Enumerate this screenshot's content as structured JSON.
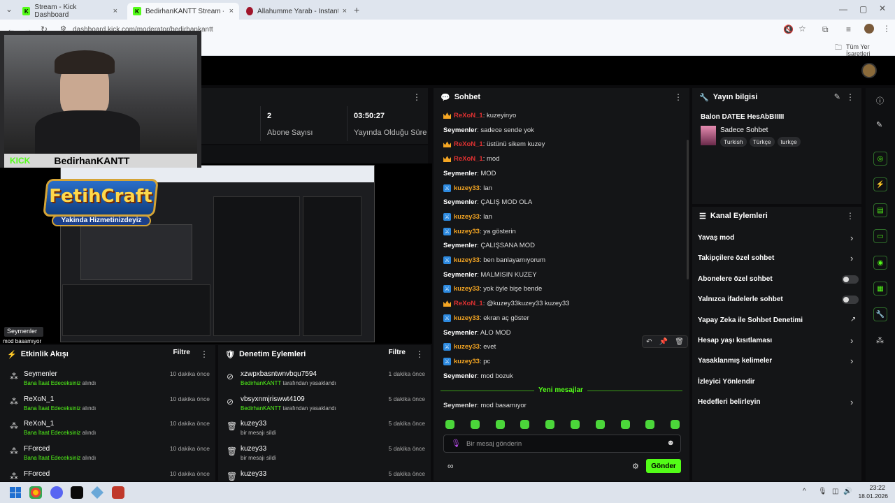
{
  "browser": {
    "tabs": [
      {
        "title": "Stream - Kick Dashboard"
      },
      {
        "title": "BedirhanKANTT Stream - Ki"
      },
      {
        "title": "Allahumme Yarab - Instant Sou"
      }
    ],
    "url": "dashboard.kick.com/moderator/bedirhankantt",
    "bookmarks_label": "Tüm Yer İşaretleri"
  },
  "webcam": {
    "brand": "KICK",
    "streamer": "BedirhanKANTT"
  },
  "overlay": {
    "title": "FetihCraft",
    "subtitle": "Yakinda Hizmetinizdeyiz",
    "chat_user": "Seymenler",
    "chat_text": "mod basamıyor"
  },
  "stats": {
    "subs_value": "2",
    "subs_label": "Abone Sayısı",
    "time_value": "03:50:27",
    "time_label": "Yayında Olduğu Süre"
  },
  "chat": {
    "title": "Sohbet",
    "messages": [
      {
        "user": "ReXoN_1",
        "text": ": kuzeyinyo",
        "badge": "crown",
        "color": "#e03131"
      },
      {
        "user": "Seymenler",
        "text": ": sadece sende yok",
        "badge": "",
        "color": "#ffffff"
      },
      {
        "user": "ReXoN_1",
        "text": ": üstünü sikem kuzey",
        "badge": "crown",
        "color": "#e03131"
      },
      {
        "user": "ReXoN_1",
        "text": ": mod",
        "badge": "crown",
        "color": "#e03131"
      },
      {
        "user": "Seymenler",
        "text": ": MOD",
        "badge": "",
        "color": "#ffffff"
      },
      {
        "user": "kuzey33",
        "text": ": lan",
        "badge": "mod",
        "color": "#f5a623"
      },
      {
        "user": "Seymenler",
        "text": ": ÇALIŞ MOD OLA",
        "badge": "",
        "color": "#ffffff"
      },
      {
        "user": "kuzey33",
        "text": ": lan",
        "badge": "mod",
        "color": "#f5a623"
      },
      {
        "user": "kuzey33",
        "text": ": ya gösterin",
        "badge": "mod",
        "color": "#f5a623"
      },
      {
        "user": "Seymenler",
        "text": ": ÇALIŞSANA MOD",
        "badge": "",
        "color": "#ffffff"
      },
      {
        "user": "kuzey33",
        "text": ": ben banlayamıyorum",
        "badge": "mod",
        "color": "#f5a623"
      },
      {
        "user": "Seymenler",
        "text": ": MALMISIN KUZEY",
        "badge": "",
        "color": "#ffffff"
      },
      {
        "user": "kuzey33",
        "text": ": yok öyle bişe bende",
        "badge": "mod",
        "color": "#f5a623"
      },
      {
        "user": "ReXoN_1",
        "text": ": @kuzey33kuzey33 kuzey33",
        "badge": "crown",
        "color": "#e03131"
      },
      {
        "user": "kuzey33",
        "text": ": ekran aç göster",
        "badge": "mod",
        "color": "#f5a623"
      },
      {
        "user": "Seymenler",
        "text": ": ALO MOD",
        "badge": "",
        "color": "#ffffff"
      },
      {
        "user": "kuzey33",
        "text": ": evet",
        "badge": "mod",
        "color": "#f5a623"
      },
      {
        "user": "kuzey33",
        "text": ": pc",
        "badge": "mod",
        "color": "#f5a623"
      },
      {
        "user": "Seymenler",
        "text": ": mod bozuk",
        "badge": "",
        "color": "#ffffff"
      }
    ],
    "new_messages_label": "Yeni mesajlar",
    "last_message": {
      "user": "Seymenler",
      "text": ": mod basamıyor"
    },
    "input_placeholder": "Bir mesaj gönderin",
    "send_label": "Gönder"
  },
  "stream_info": {
    "title": "Yayın bilgisi",
    "stream_title": "Balon DATEE HesAbBIIIII",
    "category": "Sadece Sohbet",
    "tags": [
      "Turkish",
      "Türkçe",
      "turkçe"
    ]
  },
  "channel_actions": {
    "title": "Kanal Eylemleri",
    "items": [
      {
        "label": "Yavaş mod",
        "control": "chevron"
      },
      {
        "label": "Takipçilere özel sohbet",
        "control": "chevron"
      },
      {
        "label": "Abonelere özel sohbet",
        "control": "toggle"
      },
      {
        "label": "Yalnızca ifadelerle sohbet",
        "control": "toggle"
      },
      {
        "label": "Yapay Zeka ile Sohbet Denetimi",
        "control": "external"
      },
      {
        "label": "Hesap yaşı kısıtlaması",
        "control": "chevron"
      },
      {
        "label": "Yasaklanmış kelimeler",
        "control": "chevron"
      },
      {
        "label": "İzleyici Yönlendir",
        "control": "none"
      },
      {
        "label": "Hedefleri belirleyin",
        "control": "chevron"
      }
    ]
  },
  "activity": {
    "title": "Etkinlik Akışı",
    "filter_label": "Filtre",
    "items": [
      {
        "name": "Seymenler",
        "reward": "Bana İtaat Edeceksiniz",
        "suffix": "alındı",
        "time": "10 dakika önce"
      },
      {
        "name": "ReXoN_1",
        "reward": "Bana İtaat Edeceksiniz",
        "suffix": "alındı",
        "time": "10 dakika önce"
      },
      {
        "name": "ReXoN_1",
        "reward": "Bana İtaat Edeceksiniz",
        "suffix": "alındı",
        "time": "10 dakika önce"
      },
      {
        "name": "FForced",
        "reward": "Bana İtaat Edeceksiniz",
        "suffix": "alındı",
        "time": "10 dakika önce"
      },
      {
        "name": "FForced",
        "reward": "",
        "suffix": "",
        "time": "10 dakika önce"
      }
    ]
  },
  "moderation": {
    "title": "Denetim Eylemleri",
    "filter_label": "Filtre",
    "items": [
      {
        "name": "xzwpxbasntwnvbqu7594",
        "actor": "BedirhanKANTT",
        "suffix": "tarafından yasaklandı",
        "time": "1 dakika önce",
        "icon": "ban"
      },
      {
        "name": "vbsyxnmjriswwt4109",
        "actor": "BedirhanKANTT",
        "suffix": "tarafından yasaklandı",
        "time": "5 dakika önce",
        "icon": "ban"
      },
      {
        "name": "kuzey33",
        "actor": "",
        "suffix": "bir mesajı sildi",
        "time": "5 dakika önce",
        "icon": "trash"
      },
      {
        "name": "kuzey33",
        "actor": "",
        "suffix": "bir mesajı sildi",
        "time": "5 dakika önce",
        "icon": "trash"
      },
      {
        "name": "kuzey33",
        "actor": "",
        "suffix": "",
        "time": "5 dakika önce",
        "icon": "trash"
      }
    ]
  },
  "taskbar": {
    "time": "23:22",
    "date": "18.01.2026"
  },
  "colors": {
    "accent": "#53fc18",
    "panel": "#141517",
    "background": "#0b0b0d"
  }
}
